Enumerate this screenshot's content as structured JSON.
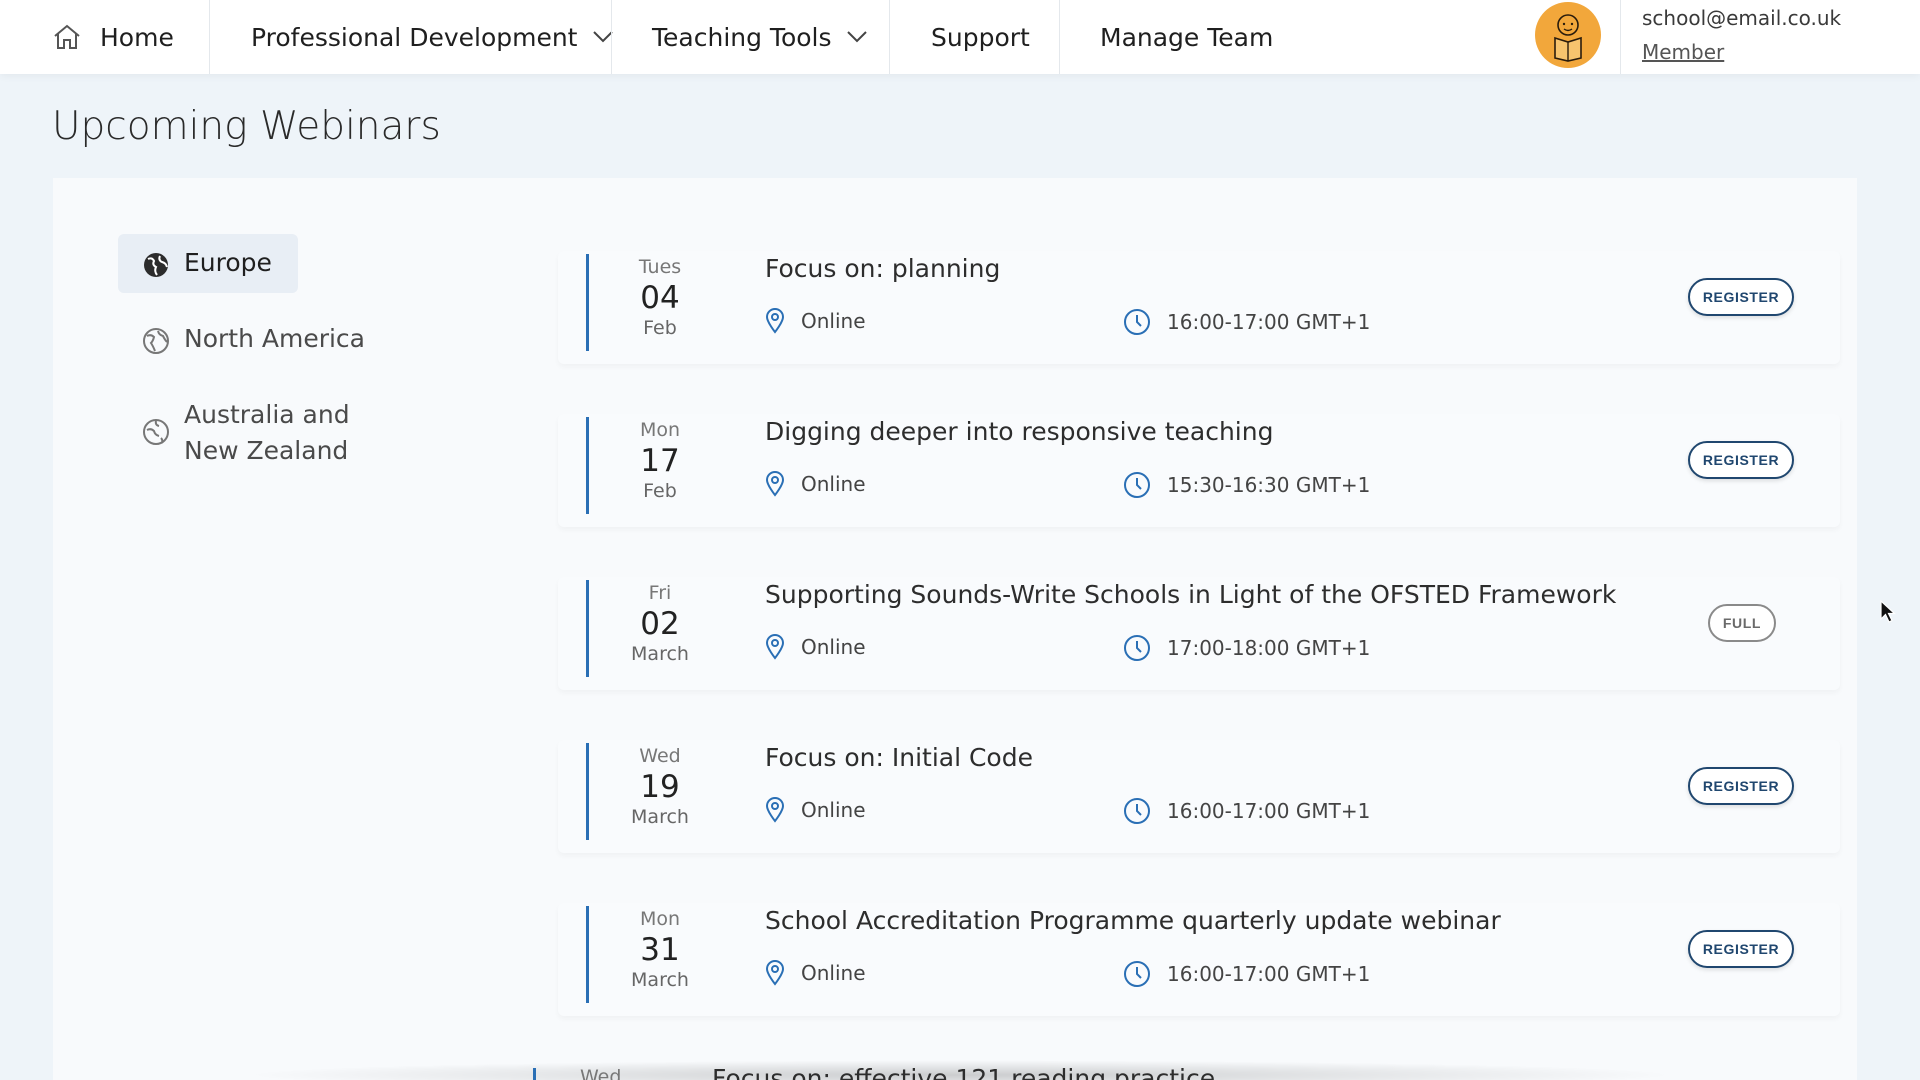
{
  "nav": {
    "home": "Home",
    "professional_development": "Professional Development",
    "teaching_tools": "Teaching Tools",
    "support": "Support",
    "manage_team": "Manage Team"
  },
  "account": {
    "email": "school@email.co.uk",
    "role": "Member",
    "avatar_color": "#f2a73b"
  },
  "page_title": "Upcoming Webinars",
  "regions": [
    {
      "label": "Europe",
      "active": true
    },
    {
      "label": "North America",
      "active": false
    },
    {
      "label_line1": "Australia and",
      "label_line2": "New Zealand",
      "active": false
    }
  ],
  "webinars": [
    {
      "dow": "Tues",
      "day": "04",
      "month": "Feb",
      "title": "Focus on: planning",
      "location": "Online",
      "time": "16:00-17:00 GMT+1",
      "action": "REGISTER"
    },
    {
      "dow": "Mon",
      "day": "17",
      "month": "Feb",
      "title": "Digging deeper into responsive teaching",
      "location": "Online",
      "time": "15:30-16:30 GMT+1",
      "action": "REGISTER"
    },
    {
      "dow": "Fri",
      "day": "02",
      "month": "March",
      "title": "Supporting Sounds-Write Schools in Light of the OFSTED Framework",
      "location": "Online",
      "time": "17:00-18:00 GMT+1",
      "action": "FULL"
    },
    {
      "dow": "Wed",
      "day": "19",
      "month": "March",
      "title": "Focus on: Initial Code",
      "location": "Online",
      "time": "16:00-17:00 GMT+1",
      "action": "REGISTER"
    },
    {
      "dow": "Mon",
      "day": "31",
      "month": "March",
      "title": "School Accreditation Programme quarterly update webinar",
      "location": "Online",
      "time": "16:00-17:00 GMT+1",
      "action": "REGISTER"
    }
  ],
  "partial_webinar": {
    "dow": "Wed",
    "title": "Focus on: effective 121 reading practice"
  },
  "colors": {
    "accent": "#2a6fb5",
    "register_border": "#20476f",
    "full_border": "#8a8a8a",
    "page_bg": "#eef4f9"
  },
  "icons": {
    "home": "home-icon",
    "chevron": "chevron-down-icon",
    "globe": "globe-icon",
    "location": "map-pin-icon",
    "time": "clock-icon"
  }
}
